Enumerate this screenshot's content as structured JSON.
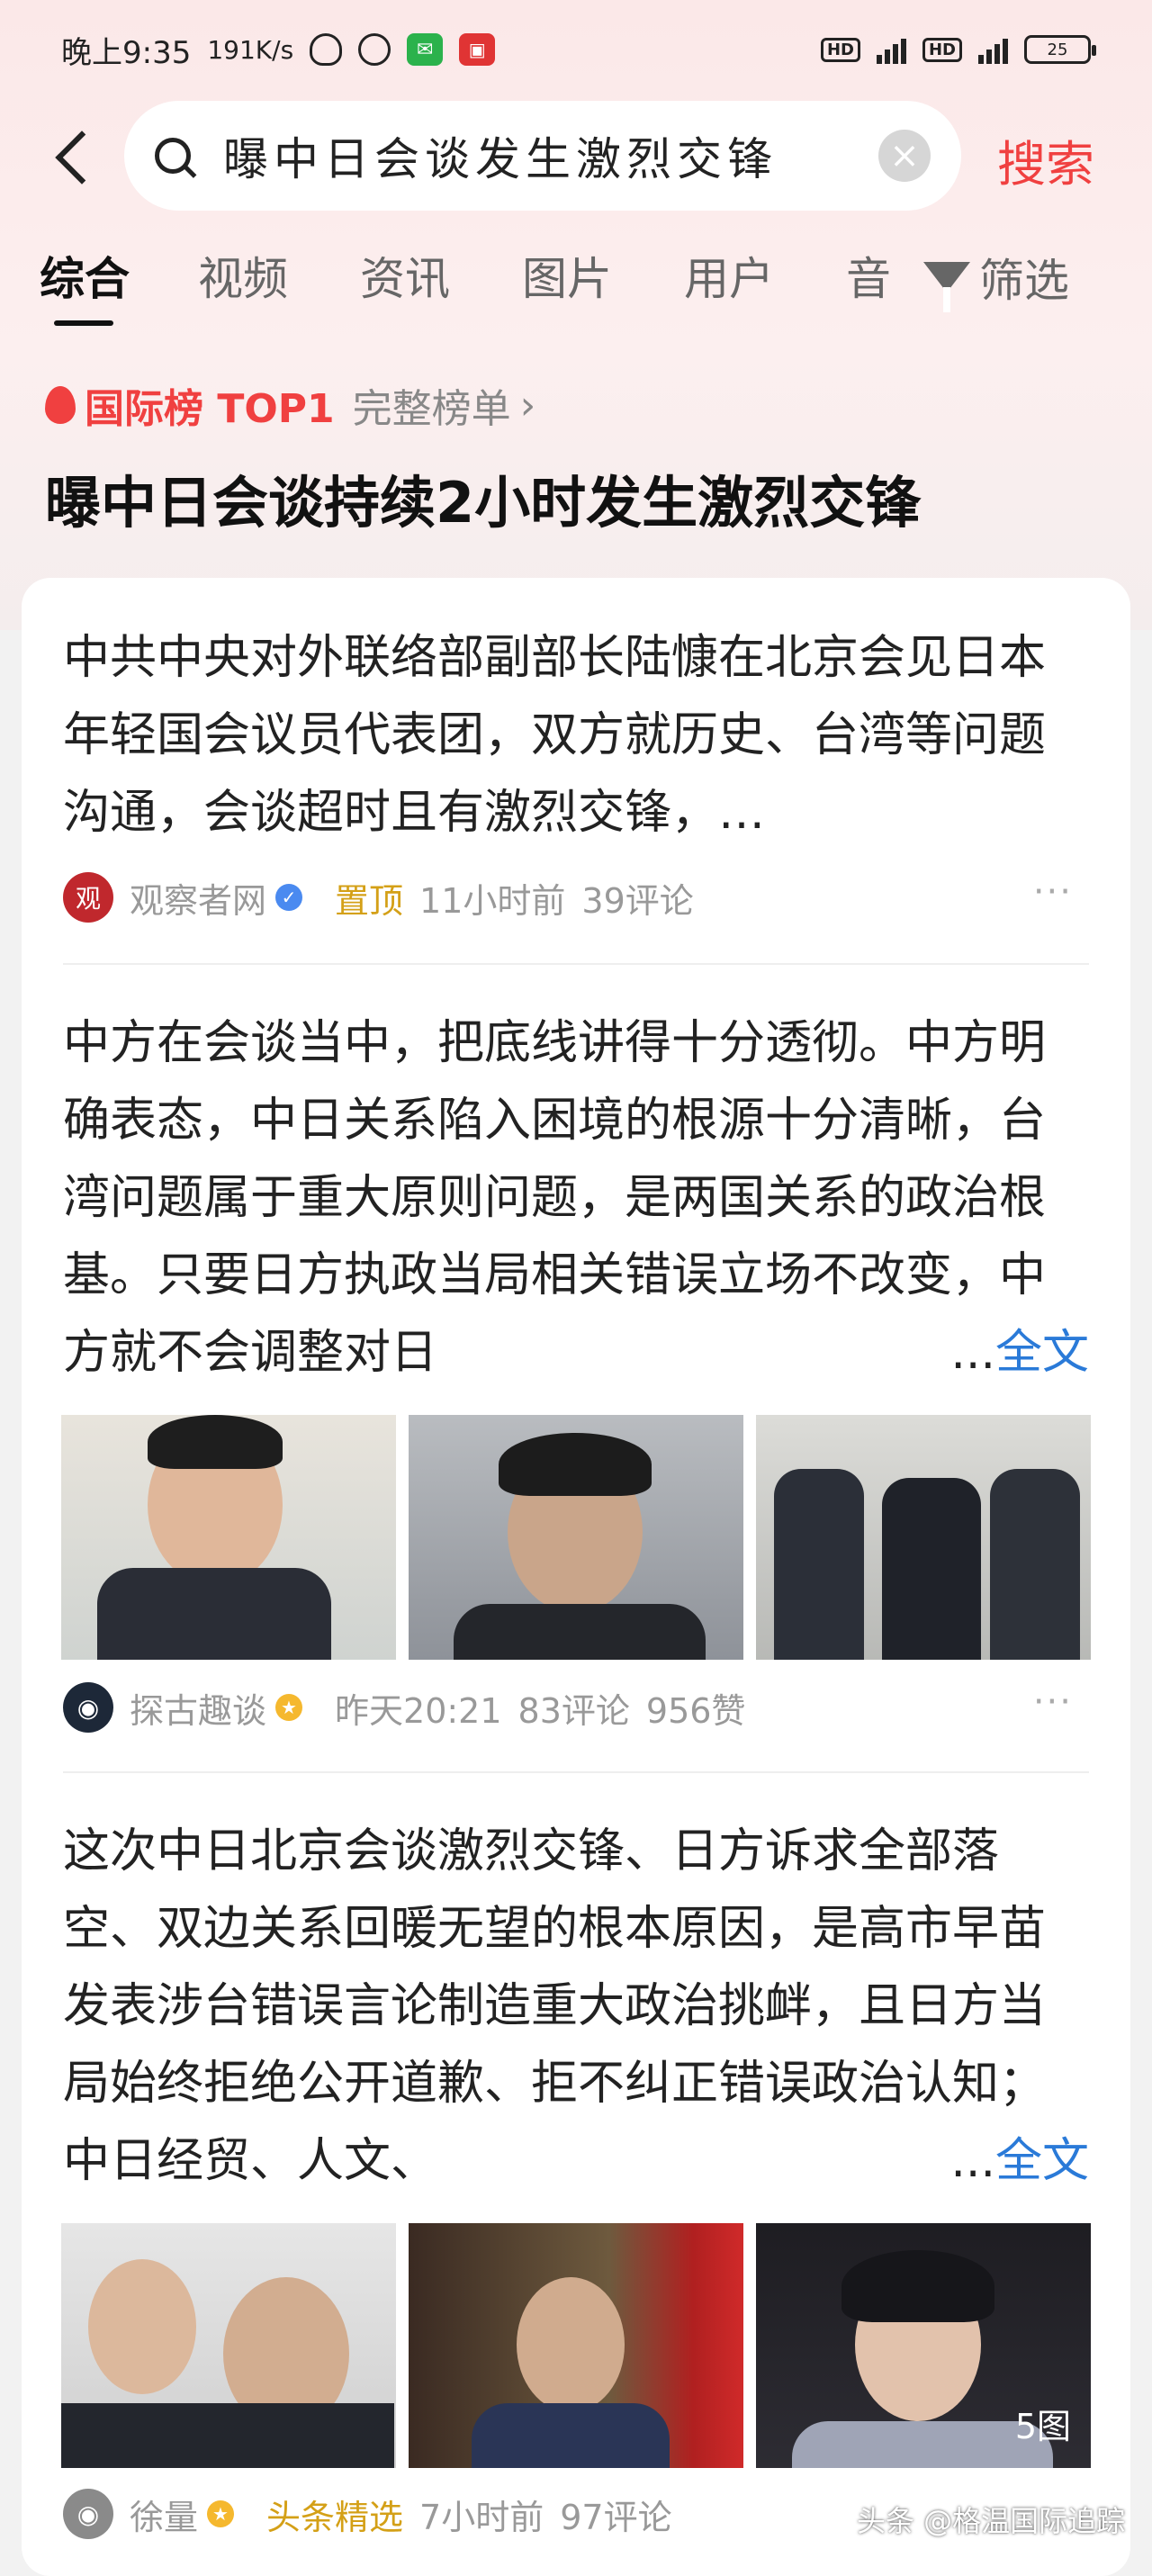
{
  "status": {
    "time": "晚上9:35",
    "speed": "191K/s",
    "network1": "HD",
    "network2": "HD",
    "battery": "25"
  },
  "search": {
    "query": "曝中日会谈发生激烈交锋",
    "button": "搜索"
  },
  "tabs": [
    "综合",
    "视频",
    "资讯",
    "图片",
    "用户",
    "音"
  ],
  "filter_label": "筛选",
  "rank": {
    "label": "国际榜 TOP1",
    "more": "完整榜单",
    "title": "曝中日会谈持续2小时发生激烈交锋"
  },
  "posts": [
    {
      "text": "中共中央对外联络部副部长陆慷在北京会见日本年轻国会议员代表团，双方就历史、台湾等问题沟通，会谈超时且有激烈交锋，…",
      "source": "观察者网",
      "pinned": "置顶",
      "time": "11小时前",
      "comments": "39评论"
    },
    {
      "text": "中方在会谈当中，把底线讲得十分透彻。中方明确表态，中日关系陷入困境的根源十分清晰，台湾问题属于重大原则问题，是两国关系的政治根基。只要日方执政当局相关错误立场不改变，中方就不会调整对日",
      "fulltext_ellipsis": "...",
      "fulltext": "全文",
      "source": "探古趣谈",
      "time": "昨天20:21",
      "comments": "83评论",
      "likes": "956赞"
    },
    {
      "text": "这次中日北京会谈激烈交锋、日方诉求全部落空、双边关系回暖无望的根本原因，是高市早苗发表涉台错误言论制造重大政治挑衅，且日方当局始终拒绝公开道歉、拒不纠正错误政治认知；中日经贸、人文、",
      "fulltext_ellipsis": "...",
      "fulltext": "全文",
      "image_count": "5图",
      "source": "徐量",
      "tag": "头条精选",
      "time": "7小时前",
      "comments": "97评论"
    }
  ],
  "watermark": "头条 @格温国际追踪",
  "colors": {
    "accent": "#f04040",
    "link": "#2a7ad8",
    "pinned": "#d4a017"
  }
}
